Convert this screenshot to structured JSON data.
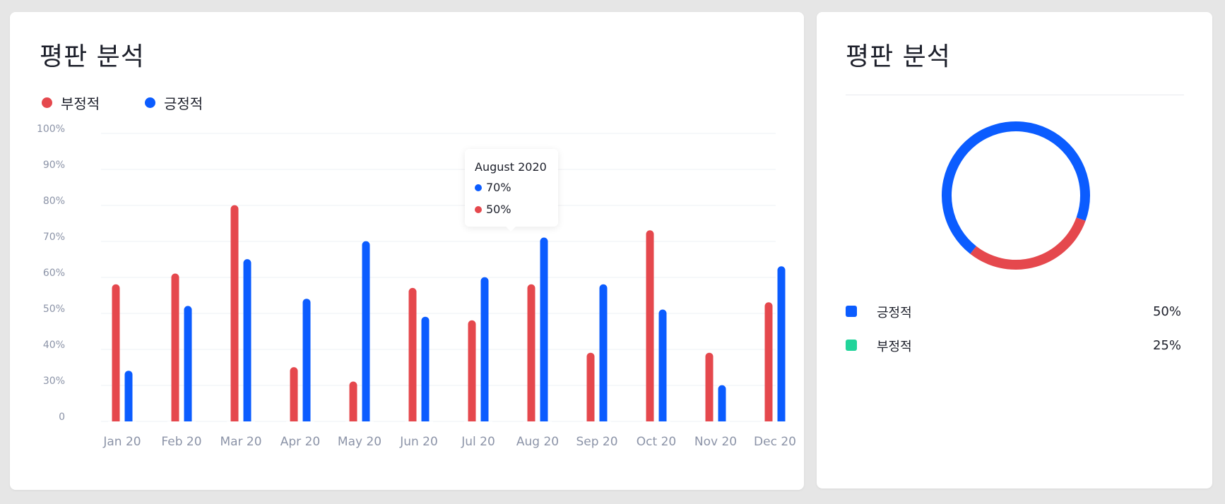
{
  "left_card": {
    "title": "평판 분석",
    "legend": [
      {
        "label": "부정적",
        "color": "#e5484d"
      },
      {
        "label": "긍정적",
        "color": "#0b5cff"
      }
    ]
  },
  "tooltip": {
    "title": "August 2020",
    "rows": [
      {
        "value": "70%",
        "color": "#0b5cff"
      },
      {
        "value": "50%",
        "color": "#e5484d"
      }
    ]
  },
  "right_card": {
    "title": "평판 분석",
    "legend": [
      {
        "label": "긍정적",
        "value": "50%",
        "color": "#0b5cff"
      },
      {
        "label": "부정적",
        "value": "25%",
        "color": "#22d49a"
      }
    ]
  },
  "chart_data": [
    {
      "type": "bar",
      "categories": [
        "Jan 20",
        "Feb 20",
        "Mar 20",
        "Apr 20",
        "May 20",
        "Jun 20",
        "Jul 20",
        "Aug 20",
        "Sep 20",
        "Oct 20",
        "Nov 20",
        "Dec 20"
      ],
      "series": [
        {
          "name": "부정적",
          "color": "#e5484d",
          "values": [
            57,
            60,
            79,
            34,
            30,
            56,
            47,
            57,
            38,
            72,
            38,
            52
          ]
        },
        {
          "name": "긍정적",
          "color": "#0b5cff",
          "values": [
            33,
            51,
            64,
            53,
            69,
            48,
            59,
            70,
            57,
            50,
            29,
            62
          ]
        }
      ],
      "yticks": [
        "0",
        "30%",
        "40%",
        "50%",
        "60%",
        "70%",
        "80%",
        "90%",
        "100%"
      ],
      "grid": true,
      "legend_position": "top-left"
    },
    {
      "type": "pie",
      "donut": true,
      "segments": [
        {
          "color": "#0b5cff",
          "value": 70
        },
        {
          "color": "#e5484d",
          "value": 30
        }
      ]
    }
  ]
}
